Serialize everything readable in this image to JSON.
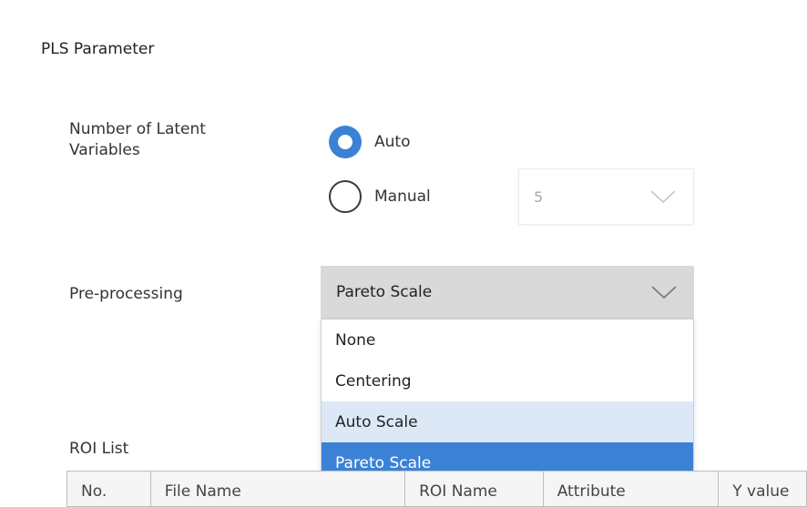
{
  "section_title": "PLS Parameter",
  "latent_variables": {
    "label": "Number of Latent Variables",
    "auto_label": "Auto",
    "manual_label": "Manual",
    "selected": "Auto",
    "manual_value": "5"
  },
  "preprocessing": {
    "label": "Pre-processing",
    "selected_value": "Pareto Scale",
    "options": [
      "None",
      "Centering",
      "Auto Scale",
      "Pareto Scale"
    ],
    "hovered_option": "Auto Scale"
  },
  "roi_list": {
    "label": "ROI List",
    "columns": [
      "No.",
      "File Name",
      "ROI Name",
      "Attribute",
      "Y value"
    ]
  },
  "colors": {
    "accent": "#3b82d6",
    "hover": "#dde8f7",
    "select_bg": "#d9d9d9"
  }
}
